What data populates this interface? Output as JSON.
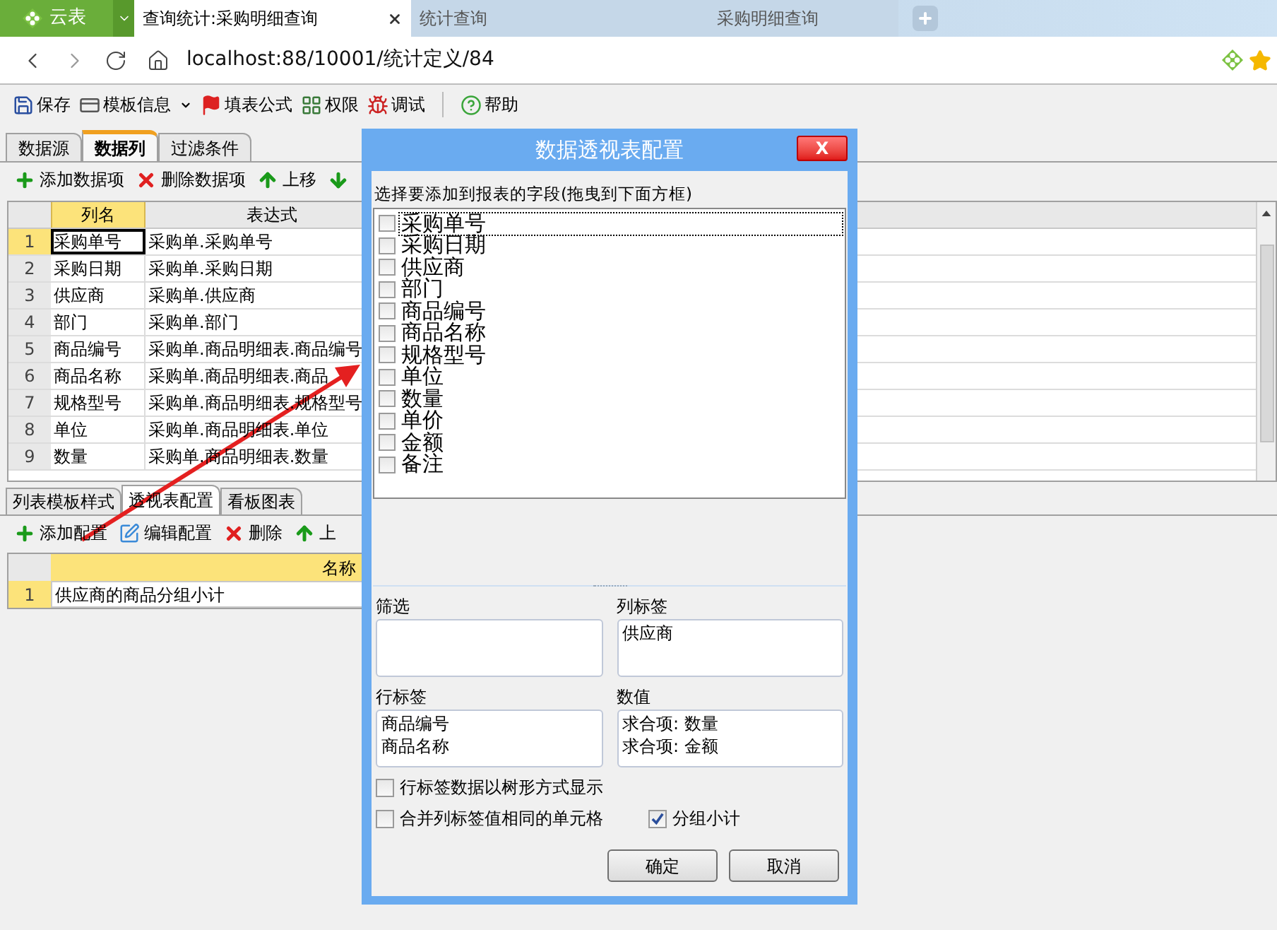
{
  "app_button": {
    "label": "云表"
  },
  "browser_tabs": [
    {
      "label": "查询统计:采购明细查询",
      "selected": true
    },
    {
      "label": "统计查询",
      "selected": false
    },
    {
      "label": "采购明细查询",
      "selected": false
    }
  ],
  "address": "localhost:88/10001/统计定义/84",
  "toolbar": [
    {
      "label": "保存",
      "dropdown": false
    },
    {
      "label": "模板信息",
      "dropdown": true
    },
    {
      "label": "填表公式",
      "dropdown": false
    },
    {
      "label": "权限",
      "dropdown": false
    },
    {
      "label": "调试",
      "dropdown": false
    },
    {
      "label": "帮助",
      "dropdown": false
    }
  ],
  "designer_tabs": [
    {
      "label": "数据源",
      "selected": false
    },
    {
      "label": "数据列",
      "selected": true
    },
    {
      "label": "过滤条件",
      "selected": false
    }
  ],
  "column_toolbar": [
    "添加数据项",
    "删除数据项",
    "上移"
  ],
  "columns_grid": {
    "columns": [
      "列名",
      "表达式"
    ],
    "rows": [
      {
        "index": "1",
        "name": "采购单号",
        "expression": "采购单.采购单号",
        "selected": true
      },
      {
        "index": "2",
        "name": "采购日期",
        "expression": "采购单.采购日期",
        "selected": false
      },
      {
        "index": "3",
        "name": "供应商",
        "expression": "采购单.供应商",
        "selected": false
      },
      {
        "index": "4",
        "name": "部门",
        "expression": "采购单.部门",
        "selected": false
      },
      {
        "index": "5",
        "name": "商品编号",
        "expression": "采购单.商品明细表.商品编号",
        "selected": false
      },
      {
        "index": "6",
        "name": "商品名称",
        "expression": "采购单.商品明细表.商品",
        "selected": false
      },
      {
        "index": "7",
        "name": "规格型号",
        "expression": "采购单.商品明细表.规格型号",
        "selected": false
      },
      {
        "index": "8",
        "name": "单位",
        "expression": "采购单.商品明细表.单位",
        "selected": false
      },
      {
        "index": "9",
        "name": "数量",
        "expression": "采购单.商品明细表.数量",
        "selected": false
      }
    ]
  },
  "bottom_tabs": [
    {
      "label": "列表模板样式",
      "selected": false
    },
    {
      "label": "透视表配置",
      "selected": true
    },
    {
      "label": "看板图表",
      "selected": false
    }
  ],
  "pivot_toolbar": [
    "添加配置",
    "编辑配置",
    "删除",
    "上"
  ],
  "pivot_grid": {
    "column": "名称",
    "rows": [
      {
        "index": "1",
        "name": "供应商的商品分组小计"
      }
    ]
  },
  "dialog": {
    "title": "数据透视表配置",
    "close": "X",
    "fields_label": "选择要添加到报表的字段(拖曳到下面方框)",
    "fields": [
      {
        "label": "采购单号",
        "checked": false,
        "focused": true
      },
      {
        "label": "采购日期",
        "checked": false,
        "focused": false
      },
      {
        "label": "供应商",
        "checked": false,
        "focused": false
      },
      {
        "label": "部门",
        "checked": false,
        "focused": false
      },
      {
        "label": "商品编号",
        "checked": false,
        "focused": false
      },
      {
        "label": "商品名称",
        "checked": false,
        "focused": false
      },
      {
        "label": "规格型号",
        "checked": false,
        "focused": false
      },
      {
        "label": "单位",
        "checked": false,
        "focused": false
      },
      {
        "label": "数量",
        "checked": false,
        "focused": false
      },
      {
        "label": "单价",
        "checked": false,
        "focused": false
      },
      {
        "label": "金额",
        "checked": false,
        "focused": false
      },
      {
        "label": "备注",
        "checked": false,
        "focused": false
      }
    ],
    "areas": [
      {
        "label": "筛选"
      },
      {
        "label": "列标签",
        "items": [
          "供应商"
        ]
      },
      {
        "label": "行标签",
        "items": [
          "商品编号",
          "商品名称"
        ]
      },
      {
        "label": "数值",
        "items": [
          "求合项: 数量",
          "求合项: 金额"
        ]
      }
    ],
    "options": [
      {
        "label": "行标签数据以树形方式显示",
        "checked": false
      },
      {
        "label": "合并列标签值相同的单元格",
        "checked": false
      },
      {
        "label": "分组小计",
        "checked": true
      }
    ],
    "buttons": [
      "确定",
      "取消"
    ]
  }
}
